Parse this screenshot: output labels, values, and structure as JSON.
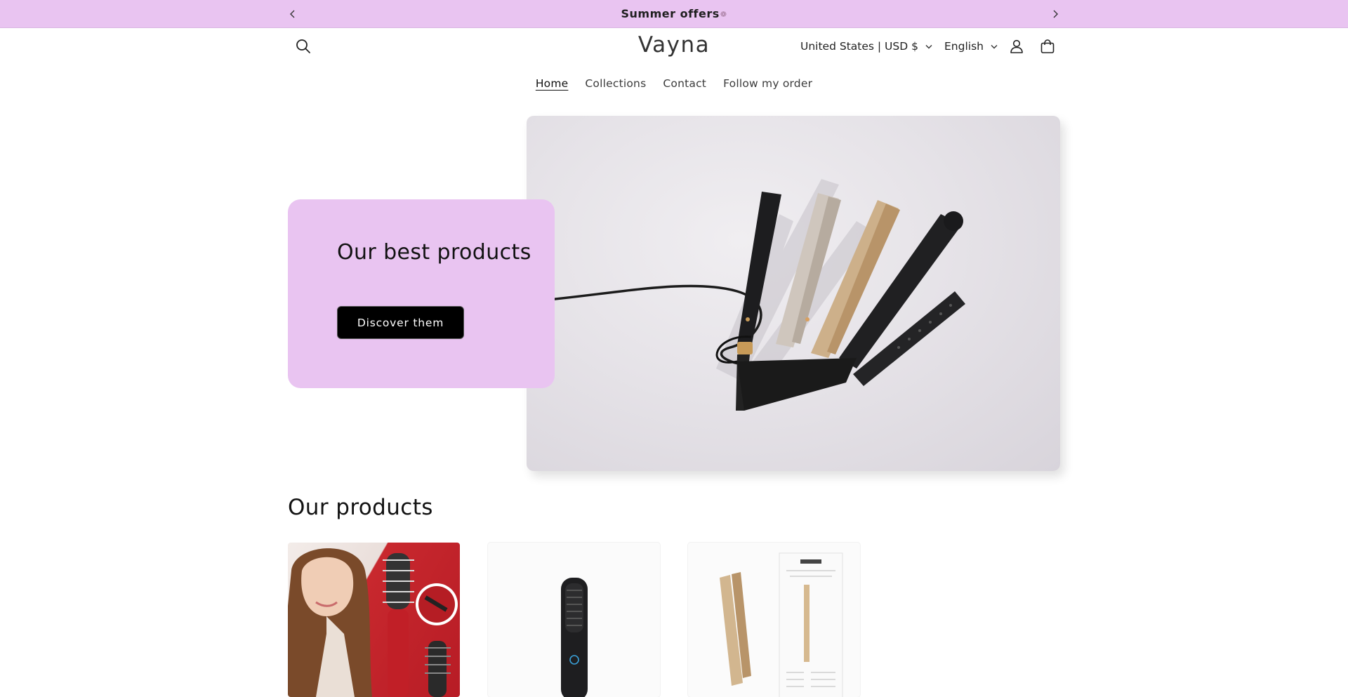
{
  "announcement": {
    "text": "Summer offers",
    "icon": "sun-icon"
  },
  "header": {
    "logo": "Vayna",
    "country_selector": "United States | USD $",
    "language_selector": "English"
  },
  "nav": {
    "items": [
      {
        "label": "Home",
        "active": true
      },
      {
        "label": "Collections",
        "active": false
      },
      {
        "label": "Contact",
        "active": false
      },
      {
        "label": "Follow my order",
        "active": false
      }
    ]
  },
  "hero": {
    "title": "Our best products",
    "button_label": "Discover them"
  },
  "products": {
    "section_title": "Our products"
  },
  "colors": {
    "accent": "#e9c4f1",
    "button": "#000000",
    "text": "#121212"
  }
}
